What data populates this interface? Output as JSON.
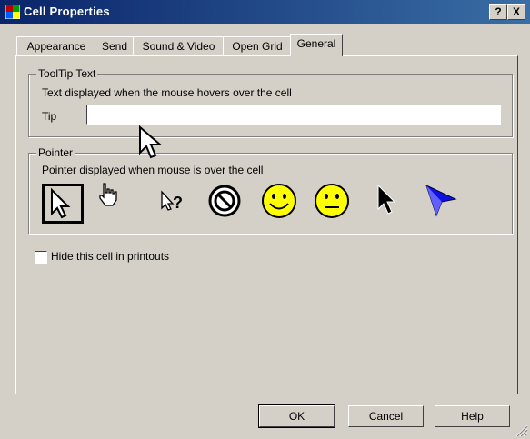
{
  "window": {
    "title": "Cell Properties",
    "help_button": "?",
    "close_button": "X"
  },
  "tabs": [
    {
      "label": "Appearance"
    },
    {
      "label": "Send"
    },
    {
      "label": "Sound & Video"
    },
    {
      "label": "Open Grid"
    },
    {
      "label": "General",
      "active": true
    }
  ],
  "tooltip_group": {
    "title": "ToolTip Text",
    "description": "Text displayed when the mouse hovers over the cell",
    "tip_label": "Tip",
    "tip_value": ""
  },
  "pointer_group": {
    "title": "Pointer",
    "description": "Pointer displayed when mouse is over the cell",
    "pointers": [
      {
        "icon": "arrow-cursor-icon",
        "selected": true
      },
      {
        "icon": "hand-cursor-icon"
      },
      {
        "icon": "help-cursor-icon"
      },
      {
        "icon": "no-entry-cursor-icon"
      },
      {
        "icon": "smiley-happy-icon"
      },
      {
        "icon": "smiley-neutral-icon"
      },
      {
        "icon": "black-arrow-cursor-icon"
      },
      {
        "icon": "blue-arrow-cursor-icon"
      }
    ]
  },
  "options": {
    "hide_in_printouts_label": "Hide this cell in printouts",
    "hide_in_printouts_checked": false
  },
  "buttons": {
    "ok": "OK",
    "cancel": "Cancel",
    "help": "Help"
  },
  "colors": {
    "titlebar_start": "#0a246a",
    "titlebar_end": "#3a6ea5",
    "dialog_face": "#d4d0c8",
    "smiley_yellow": "#ffff00",
    "blue_arrow": "#1010e0"
  }
}
